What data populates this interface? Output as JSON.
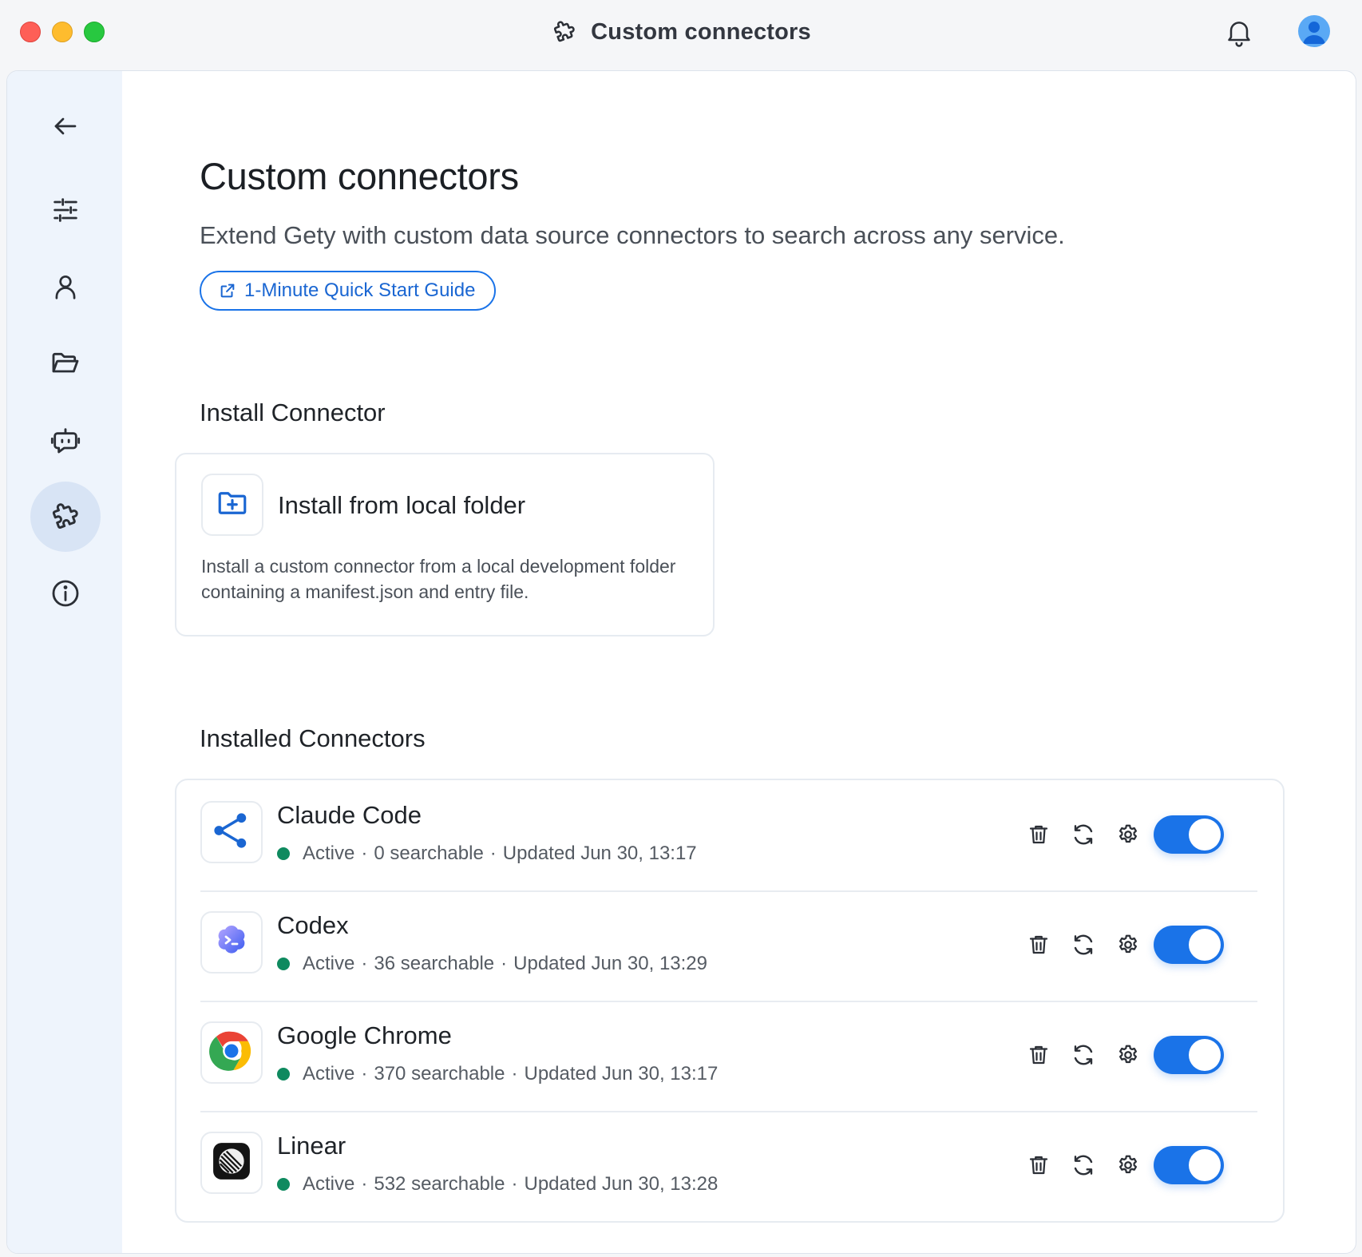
{
  "window": {
    "title": "Custom connectors"
  },
  "sidebar": {
    "items": [
      {
        "name": "back",
        "icon": "arrow-left-icon",
        "active": false
      },
      {
        "name": "settings",
        "icon": "sliders-icon",
        "active": false
      },
      {
        "name": "account",
        "icon": "user-icon",
        "active": false
      },
      {
        "name": "folders",
        "icon": "folder-open-icon",
        "active": false
      },
      {
        "name": "assistant",
        "icon": "bot-icon",
        "active": false
      },
      {
        "name": "connectors",
        "icon": "puzzle-icon",
        "active": true
      },
      {
        "name": "about",
        "icon": "info-icon",
        "active": false
      }
    ]
  },
  "page": {
    "title": "Custom connectors",
    "subtitle": "Extend Gety with custom data source connectors to search across any service.",
    "guide_button": "1-Minute Quick Start Guide"
  },
  "install": {
    "section_title": "Install Connector",
    "card_title": "Install from local folder",
    "card_desc": "Install a custom connector from a local development folder containing a manifest.json and entry file."
  },
  "installed": {
    "section_title": "Installed Connectors",
    "connectors": [
      {
        "name": "Claude Code",
        "status": "Active",
        "searchable": "0 searchable",
        "updated": "Updated Jun 30, 13:17",
        "icon": "share-nodes-icon",
        "enabled": true
      },
      {
        "name": "Codex",
        "status": "Active",
        "searchable": "36 searchable",
        "updated": "Updated Jun 30, 13:29",
        "icon": "codex-terminal-icon",
        "enabled": true
      },
      {
        "name": "Google Chrome",
        "status": "Active",
        "searchable": "370 searchable",
        "updated": "Updated Jun 30, 13:17",
        "icon": "chrome-icon",
        "enabled": true
      },
      {
        "name": "Linear",
        "status": "Active",
        "searchable": "532 searchable",
        "updated": "Updated Jun 30, 13:28",
        "icon": "linear-icon",
        "enabled": true
      }
    ]
  },
  "colors": {
    "accent": "#1a73e8",
    "status_active": "#0f8a5f",
    "sidebar_bg": "#eef4fc"
  },
  "separator": "·"
}
